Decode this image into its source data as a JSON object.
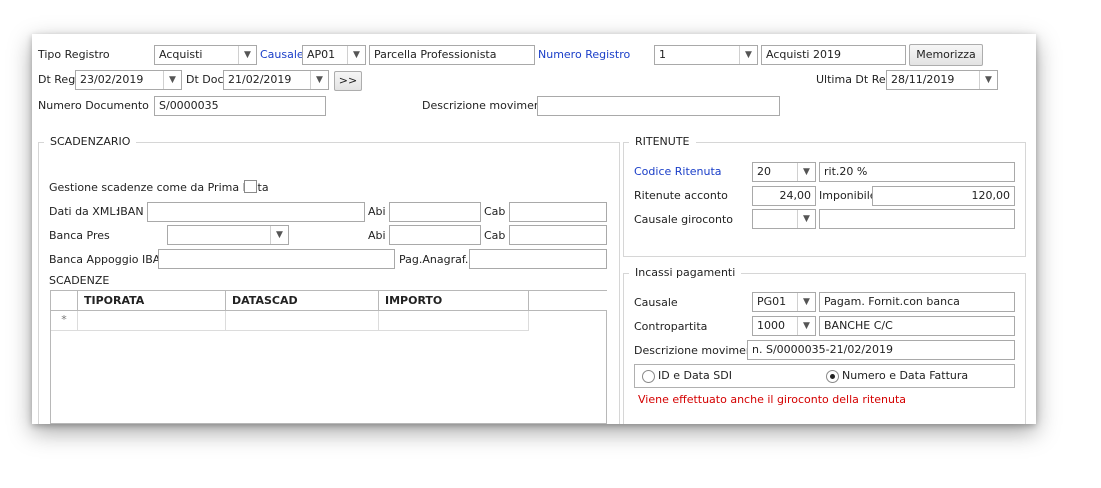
{
  "header": {
    "tipo_registro_label": "Tipo Registro",
    "tipo_registro_value": "Acquisti",
    "causale_label": "Causale",
    "causale_code": "AP01",
    "causale_desc": "Parcella Professionista",
    "numero_registro_label": "Numero Registro",
    "numero_registro_value": "1",
    "registro_desc": "Acquisti 2019",
    "memorizza_label": "Memorizza",
    "dt_reg_label": "Dt Reg",
    "dt_reg_value": "23/02/2019",
    "dt_doc_label": "Dt Doc",
    "dt_doc_value": "21/02/2019",
    "next_label": ">>",
    "ultima_dt_reg_label": "Ultima Dt Reg",
    "ultima_dt_reg_value": "28/11/2019",
    "numero_documento_label": "Numero Documento",
    "numero_documento_value": "S/0000035",
    "descrizione_movimento_label": "Descrizione movimento",
    "descrizione_movimento_value": ""
  },
  "scadenzario": {
    "title": "SCADENZARIO",
    "gestione_label": "Gestione scadenze come da Prima Nota",
    "gestione_checked": false,
    "dati_xml_label": "Dati da XML:",
    "iban_label": "IBAN",
    "iban_value": "",
    "abi_label": "Abi",
    "cab_label": "Cab",
    "banca_pres_label": "Banca Pres",
    "banca_pres_value": "",
    "banca_appoggio_label": "Banca Appoggio IBAN",
    "pag_anagraf_label": "Pag.Anagraf.",
    "scadenze_label": "SCADENZE",
    "columns": [
      "TIPORATA",
      "DATASCAD",
      "IMPORTO"
    ],
    "new_row_marker": "*"
  },
  "ritenute": {
    "title": "RITENUTE",
    "codice_label": "Codice Ritenuta",
    "codice_value": "20",
    "codice_desc": "rit.20 %",
    "acconto_label": "Ritenute acconto",
    "acconto_value": "24,00",
    "imponibile_label": "Imponibile",
    "imponibile_value": "120,00",
    "causale_giroconto_label": "Causale giroconto",
    "causale_giroconto_value": "",
    "causale_giroconto_desc": ""
  },
  "incassi": {
    "title": "Incassi pagamenti",
    "causale_label": "Causale",
    "causale_code": "PG01",
    "causale_desc": "Pagam. Fornit.con banca",
    "contropartita_label": "Contropartita",
    "contropartita_code": "1000",
    "contropartita_desc": "BANCHE C/C",
    "descrizione_label": "Descrizione movimento",
    "descrizione_value": "n. S/0000035-21/02/2019",
    "radio_sdi_label": "ID e Data SDI",
    "radio_fattura_label": "Numero e Data Fattura",
    "selected_radio": "Numero e Data Fattura",
    "warning": "Viene effettuato anche il giroconto della ritenuta",
    "warning_color": "#d40000",
    "link_color": "#1a3ec8"
  }
}
